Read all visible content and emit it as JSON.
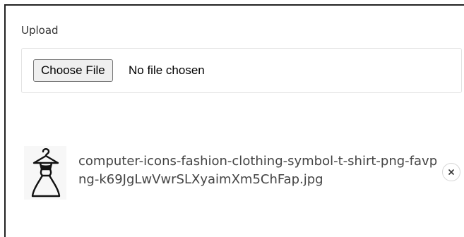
{
  "upload": {
    "label": "Upload",
    "choose_button_label": "Choose File",
    "status_text": "No file chosen"
  },
  "uploaded_file": {
    "name": "computer-icons-fashion-clothing-symbol-t-shirt-png-favpng-k69JgLwVwrSLXyaimXm5ChFap.jpg",
    "thumbnail_icon": "dress-on-hanger-icon",
    "remove_icon": "close-icon"
  },
  "colors": {
    "text": "#333333",
    "filename_text": "#444444",
    "border": "#e2e2e2",
    "button_bg": "#efefef"
  }
}
